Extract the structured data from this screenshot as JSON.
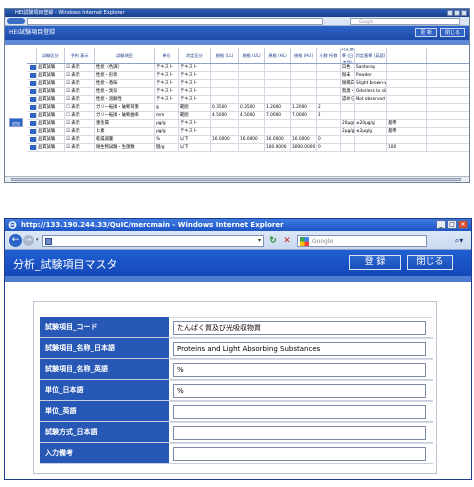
{
  "window1": {
    "title": "HEI試験項目登録 - Windows Internet Explorer",
    "search_placeholder": "Google",
    "page_title": "HEI試験項目登録",
    "buttons": [
      "更 新",
      "閉じる"
    ],
    "side_button": "追加",
    "columns": [
      "",
      "試験区分",
      "予約\n表示",
      "試験項目",
      "単位",
      "判定区分",
      "規格\n(LL)",
      "規格\n(UL)",
      "規格\n(HL)",
      "規格\n(HU)",
      "小数\n桁数",
      "判定基準\n(日本語)",
      "判定基準\n(英語)",
      ""
    ],
    "rows": [
      [
        "",
        "品質試験",
        "☑ 表示",
        "性状（色調）",
        "テキスト",
        "テキスト",
        "",
        "",
        "",
        "",
        "",
        "白色",
        "Santoray",
        ""
      ],
      [
        "",
        "品質試験",
        "☑ 表示",
        "性状・形状",
        "テキスト",
        "テキスト",
        "",
        "",
        "",
        "",
        "",
        "粉末",
        "Powder",
        ""
      ],
      [
        "",
        "品質試験",
        "☑ 表示",
        "性状・香味",
        "テキスト",
        "テキスト",
        "",
        "",
        "",
        "",
        "",
        "微褐白色",
        "Slight brown-wh",
        ""
      ],
      [
        "",
        "品質試験",
        "☑ 表示",
        "性状・臭気",
        "テキスト",
        "テキスト",
        "",
        "",
        "",
        "",
        "",
        "無臭・わずかな",
        "Odorless to slig",
        ""
      ],
      [
        "",
        "品質試験",
        "☑ 表示",
        "性状・溶解性",
        "テキスト",
        "テキスト",
        "",
        "",
        "",
        "",
        "",
        "認められない",
        "Not observed for",
        ""
      ],
      [
        "",
        "品質試験",
        "☐ 表示",
        "ガリー転換・破断荷重",
        "g",
        "範囲",
        "0.3500",
        "0.3500",
        "1.2000",
        "1.2000",
        "2",
        "",
        "",
        ""
      ],
      [
        "",
        "品質試験",
        "☐ 表示",
        "ガリー転換・破断曲率",
        "mm",
        "範囲",
        "4.5000",
        "4.5000",
        "7.0000",
        "7.0000",
        "1",
        "",
        "",
        ""
      ],
      [
        "",
        "品質試験",
        "☑ 表示",
        "重金属",
        "µg/g",
        "テキスト",
        "",
        "",
        "",
        "",
        "",
        "20µg/g以下",
        "≤20µg/g",
        "基準"
      ],
      [
        "",
        "品質試験",
        "☑ 表示",
        "ヒ素",
        "µg/g",
        "テキスト",
        "",
        "",
        "",
        "",
        "",
        "2µg/g以下",
        "≤2µg/g",
        "基準"
      ],
      [
        "",
        "品質試験",
        "☑ 表示",
        "乾燥減量",
        "%",
        "以下",
        "16.0000",
        "16.0000",
        "16.0000",
        "16.0000",
        "0",
        "",
        "",
        ""
      ],
      [
        "",
        "品質試験",
        "☑ 表示",
        "微生物試験・生菌数",
        "個/g",
        "以下",
        "",
        "",
        "100.0000",
        "3000.0000",
        "0",
        "",
        "",
        "100"
      ]
    ]
  },
  "window2": {
    "title": "http://133.190.244.33/QuIC/mercmain - Windows Internet Explorer",
    "search_placeholder": "Google",
    "page_title": "分析_試験項目マスタ",
    "register_button": "登 録",
    "close_button": "閉じる",
    "form": [
      {
        "label": "試験項目_コード",
        "value": "たんぱく質及び光吸収物質"
      },
      {
        "label": "試験項目_名称_日本語",
        "value": "Proteins and Light Absorbing Substances"
      },
      {
        "label": "試験項目_名称_英語",
        "value": "%"
      },
      {
        "label": "単位_日本語",
        "value": "%"
      },
      {
        "label": "単位_英語",
        "value": ""
      },
      {
        "label": "試験方式_日本語",
        "value": ""
      },
      {
        "label": "入力備考",
        "value": ""
      }
    ]
  },
  "colors": {
    "accent": "#1f5fd3",
    "label_bg": "#2858b6",
    "title_bar": "#3d79e0"
  }
}
